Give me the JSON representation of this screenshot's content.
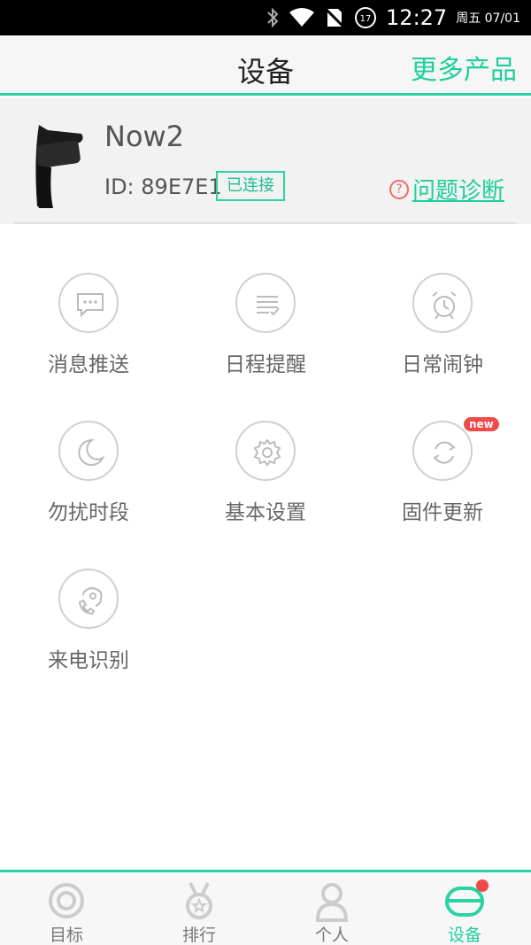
{
  "status_bar": {
    "time": "12:27",
    "date": "周五 07/01",
    "notification_count": "17"
  },
  "header": {
    "title": "设备",
    "more_products": "更多产品"
  },
  "device": {
    "name": "Now2",
    "id": "ID: 89E7E1",
    "status": "已连接",
    "diagnose": "问题诊断"
  },
  "features": [
    {
      "label": "消息推送",
      "icon": "message-icon"
    },
    {
      "label": "日程提醒",
      "icon": "schedule-icon"
    },
    {
      "label": "日常闹钟",
      "icon": "alarm-icon"
    },
    {
      "label": "勿扰时段",
      "icon": "moon-icon"
    },
    {
      "label": "基本设置",
      "icon": "gear-icon"
    },
    {
      "label": "固件更新",
      "icon": "refresh-icon",
      "badge": "new"
    },
    {
      "label": "来电识别",
      "icon": "phone-icon"
    }
  ],
  "tabs": [
    {
      "label": "目标",
      "icon": "target-icon"
    },
    {
      "label": "排行",
      "icon": "medal-icon"
    },
    {
      "label": "个人",
      "icon": "person-icon"
    },
    {
      "label": "设备",
      "icon": "band-icon",
      "active": true
    }
  ],
  "colors": {
    "accent": "#2ad3a5",
    "alert": "#f04a4a"
  }
}
